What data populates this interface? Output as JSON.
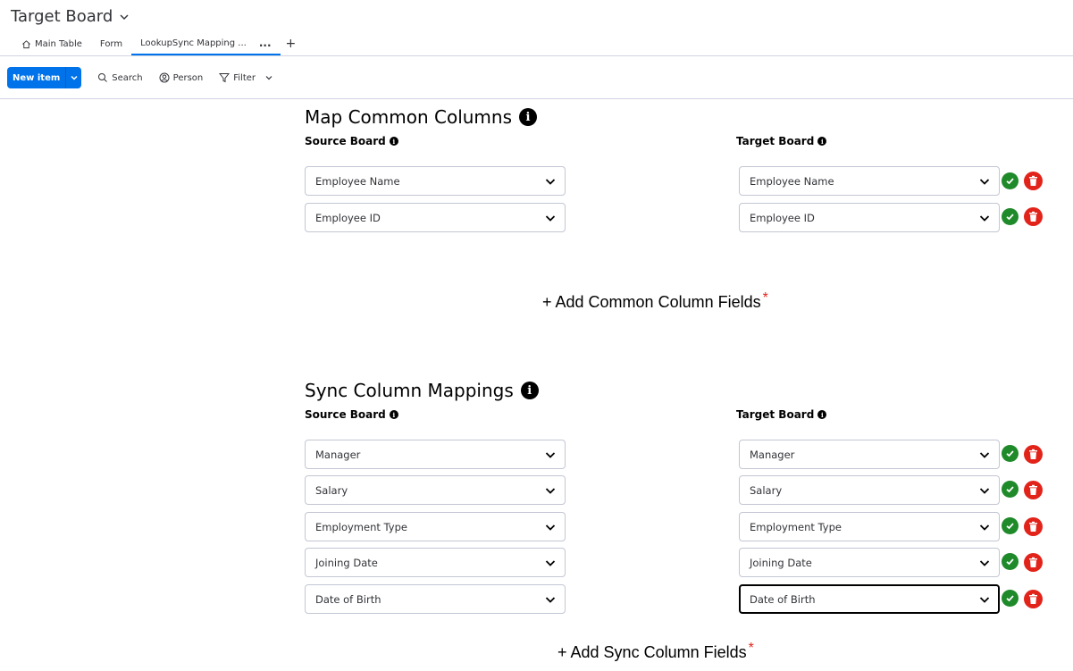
{
  "header": {
    "board_title": "Target Board"
  },
  "tabs": [
    {
      "label": "Main Table",
      "icon": "home-icon"
    },
    {
      "label": "Form"
    },
    {
      "label": "LookupSync Mapping ...",
      "active": true,
      "more": "..."
    }
  ],
  "tab_add": "+",
  "toolbar": {
    "new_item": "New item",
    "search": "Search",
    "person": "Person",
    "filter": "Filter"
  },
  "common": {
    "title": "Map Common Columns",
    "source_label": "Source Board",
    "target_label": "Target Board",
    "rows": [
      {
        "source": "Employee Name",
        "target": "Employee Name"
      },
      {
        "source": "Employee ID",
        "target": "Employee ID"
      }
    ],
    "add_label": "+ Add Common Column Fields",
    "required_mark": "*"
  },
  "sync": {
    "title": "Sync Column Mappings",
    "source_label": "Source Board",
    "target_label": "Target Board",
    "rows": [
      {
        "source": "Manager",
        "target": "Manager"
      },
      {
        "source": "Salary",
        "target": "Salary"
      },
      {
        "source": "Employment Type",
        "target": "Employment Type"
      },
      {
        "source": "Joining Date",
        "target": "Joining Date"
      },
      {
        "source": "Date of Birth",
        "target": "Date of Birth"
      }
    ],
    "add_label": "+ Add Sync Column Fields",
    "required_mark": "*"
  },
  "colors": {
    "accent": "#0073ea",
    "success": "#1f8a2a",
    "danger": "#e2231a"
  }
}
